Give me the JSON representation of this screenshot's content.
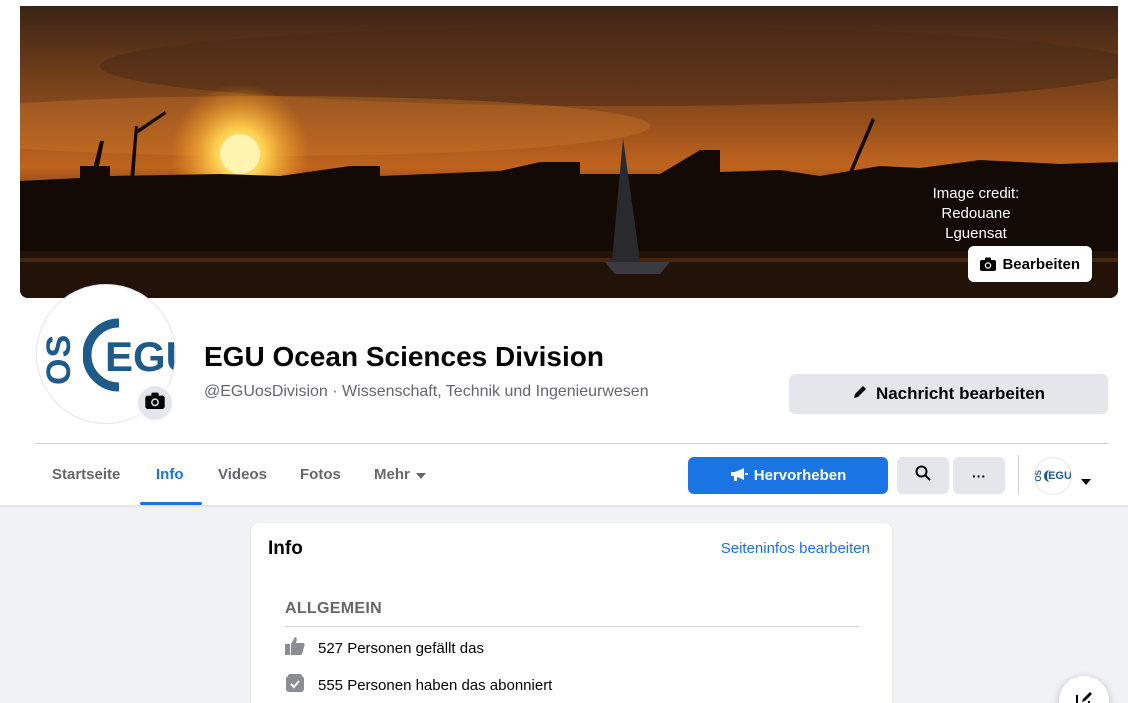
{
  "cover": {
    "credit_line1": "Image credit:",
    "credit_line2": "Redouane",
    "credit_line3": "Lguensat",
    "edit_label": "Bearbeiten"
  },
  "profile": {
    "logo_os": "OS",
    "logo_egu": "EGU",
    "name": "EGU Ocean Sciences Division",
    "subtitle": "@EGUosDivision · Wissenschaft, Technik und Ingenieurwesen",
    "message_button": "Nachricht bearbeiten"
  },
  "nav": {
    "tabs": [
      {
        "label": "Startseite"
      },
      {
        "label": "Info"
      },
      {
        "label": "Videos"
      },
      {
        "label": "Fotos"
      },
      {
        "label": "Mehr"
      }
    ],
    "active_tab": "Info",
    "boost_label": "Hervorheben",
    "more_dots": "···"
  },
  "info_card": {
    "title": "Info",
    "edit_link": "Seiteninfos bearbeiten",
    "section": "ALLGEMEIN",
    "likes": "527 Personen gefällt das",
    "followers": "555 Personen haben das abonniert"
  },
  "colors": {
    "accent": "#1b74e4",
    "logo_blue": "#1e5a8a",
    "background": "#f0f2f5"
  },
  "icons": [
    "camera-icon",
    "pencil-icon",
    "megaphone-icon",
    "search-icon",
    "more-icon",
    "chevron-down-icon",
    "like-icon",
    "subscribe-icon",
    "compose-icon"
  ]
}
